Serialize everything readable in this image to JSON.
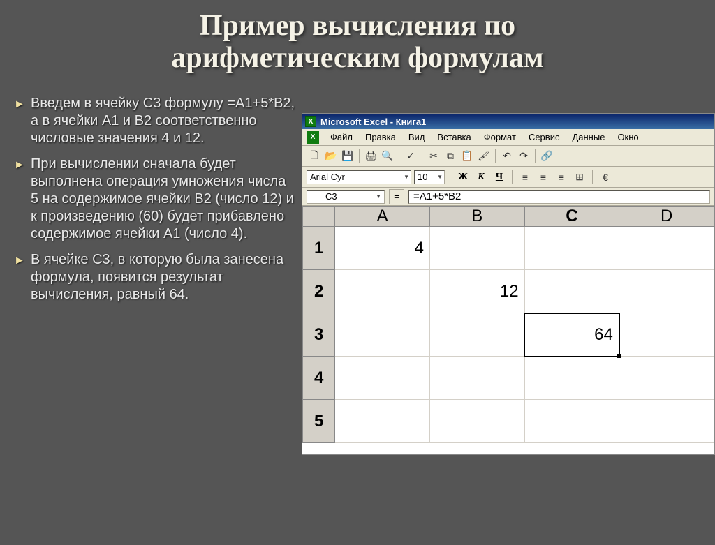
{
  "title_line1": "Пример вычисления по",
  "title_line2": "арифметическим формулам",
  "bullets": [
    "Введем в ячейку С3 формулу =А1+5*В2, а в ячейки А1 и В2 соответственно числовые значения 4 и 12.",
    "При вычислении сначала будет выполнена операция умножения числа 5 на содержимое ячейки В2 (число 12) и к произведению (60) будет прибавлено содержимое ячейки А1 (число 4).",
    "В ячейке С3, в которую была занесена формула, появится результат вычисления, равный 64."
  ],
  "excel": {
    "window_title": "Microsoft Excel - Книга1",
    "menu": [
      "Файл",
      "Правка",
      "Вид",
      "Вставка",
      "Формат",
      "Сервис",
      "Данные",
      "Окно"
    ],
    "font_name": "Arial Cyr",
    "font_size": "10",
    "fmt_bold": "Ж",
    "fmt_italic": "К",
    "fmt_underline": "Ч",
    "name_box": "C3",
    "formula": "=A1+5*B2",
    "columns": [
      "A",
      "B",
      "C",
      "D"
    ],
    "rows": [
      "1",
      "2",
      "3",
      "4",
      "5"
    ],
    "cells": {
      "A1": "4",
      "B2": "12",
      "C3": "64"
    },
    "active_col": "C",
    "active_row": "3"
  }
}
